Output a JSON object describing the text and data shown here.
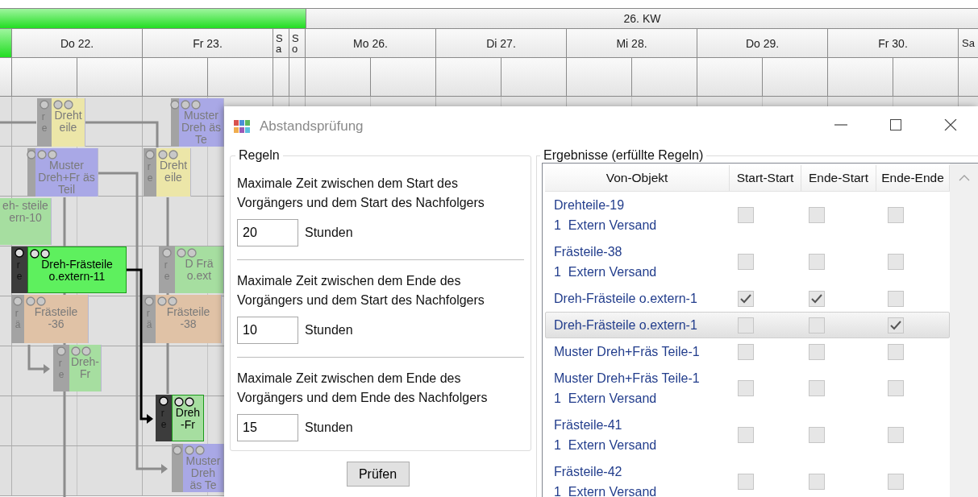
{
  "gantt": {
    "week_label": "26. KW",
    "days": [
      {
        "label": "Do 22.",
        "kind": "weekday"
      },
      {
        "label": "Fr 23.",
        "kind": "weekday"
      },
      {
        "label": "Sa",
        "kind": "weekend"
      },
      {
        "label": "So",
        "kind": "weekend"
      },
      {
        "label": "Mo 26.",
        "kind": "weekday"
      },
      {
        "label": "Di 27.",
        "kind": "weekday"
      },
      {
        "label": "Mi 28.",
        "kind": "weekday"
      },
      {
        "label": "Do 29.",
        "kind": "weekday"
      },
      {
        "label": "Fr 30.",
        "kind": "weekday"
      },
      {
        "label": "Sa",
        "kind": "weekend"
      }
    ],
    "bars": [
      {
        "prefix": "re",
        "text": "Drehteile",
        "color": "#ece6a8",
        "highlighted": false
      },
      {
        "text": "Muster Dreh äs Te",
        "color": "#a9a8e6",
        "highlighted": false
      },
      {
        "text": "Muster Dreh+Fr äs Teil",
        "color": "#a9a8e6",
        "highlighted": false
      },
      {
        "prefix": "re",
        "text": "Drehteile",
        "color": "#ece6a8",
        "highlighted": false
      },
      {
        "text": "eh- steile ern-10",
        "color": "#a6dea0",
        "highlighted": false
      },
      {
        "prefix": "re",
        "text": "Dreh-Frästeile o.extern-11",
        "color": "#5ef05e",
        "highlighted": true
      },
      {
        "prefix": "re",
        "text": "D Frä o.ext",
        "color": "#a6dea0",
        "highlighted": false
      },
      {
        "prefix": "rä",
        "text": "Frästeile -36",
        "color": "#e0c2a6",
        "highlighted": false
      },
      {
        "prefix": "rä",
        "text": "Frästeile -38",
        "color": "#e0c2a6",
        "highlighted": false
      },
      {
        "prefix": "re",
        "text": "Dreh-Fr",
        "color": "#a6dea0",
        "highlighted": false
      },
      {
        "prefix": "re",
        "text": "Dreh-Fr",
        "color": "#a6dea0",
        "highlighted": true
      },
      {
        "text": "Muster Dreh äs Te",
        "color": "#a9a8e6",
        "highlighted": false
      }
    ]
  },
  "dialog": {
    "title": "Abstandsprüfung",
    "rules": {
      "title": "Regeln",
      "items": [
        {
          "text": "Maximale Zeit zwischen dem Start des Vorgängers und dem Start des Nachfolgers",
          "value": "20",
          "unit": "Stunden"
        },
        {
          "text": "Maximale Zeit zwischen dem Ende des Vorgängers und dem Start des Nachfolgers",
          "value": "10",
          "unit": "Stunden"
        },
        {
          "text": "Maximale Zeit zwischen dem Ende des Vorgängers und dem Ende des Nachfolgers",
          "value": "15",
          "unit": "Stunden"
        }
      ]
    },
    "check_button": "Prüfen",
    "results": {
      "title": "Ergebnisse (erfüllte Regeln)",
      "columns": [
        "Von-Objekt",
        "Start-Start",
        "Ende-Start",
        "Ende-Ende"
      ],
      "rows": [
        {
          "lines": [
            "Drehteile-19",
            "1  Extern Versand"
          ],
          "checks": [
            false,
            false,
            false
          ],
          "selected": false
        },
        {
          "lines": [
            "Frästeile-38",
            "1  Extern Versand"
          ],
          "checks": [
            false,
            false,
            false
          ],
          "selected": false
        },
        {
          "lines": [
            "Dreh-Frästeile o.extern-1"
          ],
          "checks": [
            true,
            true,
            false
          ],
          "selected": false
        },
        {
          "lines": [
            "Dreh-Frästeile o.extern-1"
          ],
          "checks": [
            false,
            false,
            true
          ],
          "selected": true
        },
        {
          "lines": [
            "Muster Dreh+Fräs Teile-1"
          ],
          "checks": [
            false,
            false,
            false
          ],
          "selected": false
        },
        {
          "lines": [
            "Muster Dreh+Fräs Teile-1",
            "1  Extern Versand"
          ],
          "checks": [
            false,
            false,
            false
          ],
          "selected": false
        },
        {
          "lines": [
            "Frästeile-41",
            "1  Extern Versand"
          ],
          "checks": [
            false,
            false,
            false
          ],
          "selected": false
        },
        {
          "lines": [
            "Frästeile-42",
            "1  Extern Versand"
          ],
          "checks": [
            false,
            false,
            false
          ],
          "selected": false
        }
      ]
    }
  }
}
